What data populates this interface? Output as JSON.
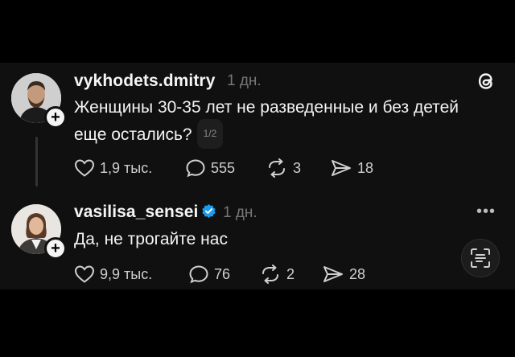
{
  "posts": [
    {
      "username": "vykhodets.dmitry",
      "time": "1 дн.",
      "text_line1": "Женщины 30-35 лет не разведенные и без детей",
      "text_line2": "еще остались?",
      "page_indicator": "1/2",
      "likes": "1,9 тыс.",
      "comments": "555",
      "reposts": "3",
      "shares": "18"
    },
    {
      "username": "vasilisa_sensei",
      "verified": true,
      "time": "1 дн.",
      "text_line1": "Да, не трогайте нас",
      "likes": "9,9 тыс.",
      "comments": "76",
      "reposts": "2",
      "shares": "28"
    }
  ],
  "more_menu": "•••",
  "colors": {
    "background": "#101010",
    "verified": "#1d9bf0",
    "muted": "#777777"
  }
}
